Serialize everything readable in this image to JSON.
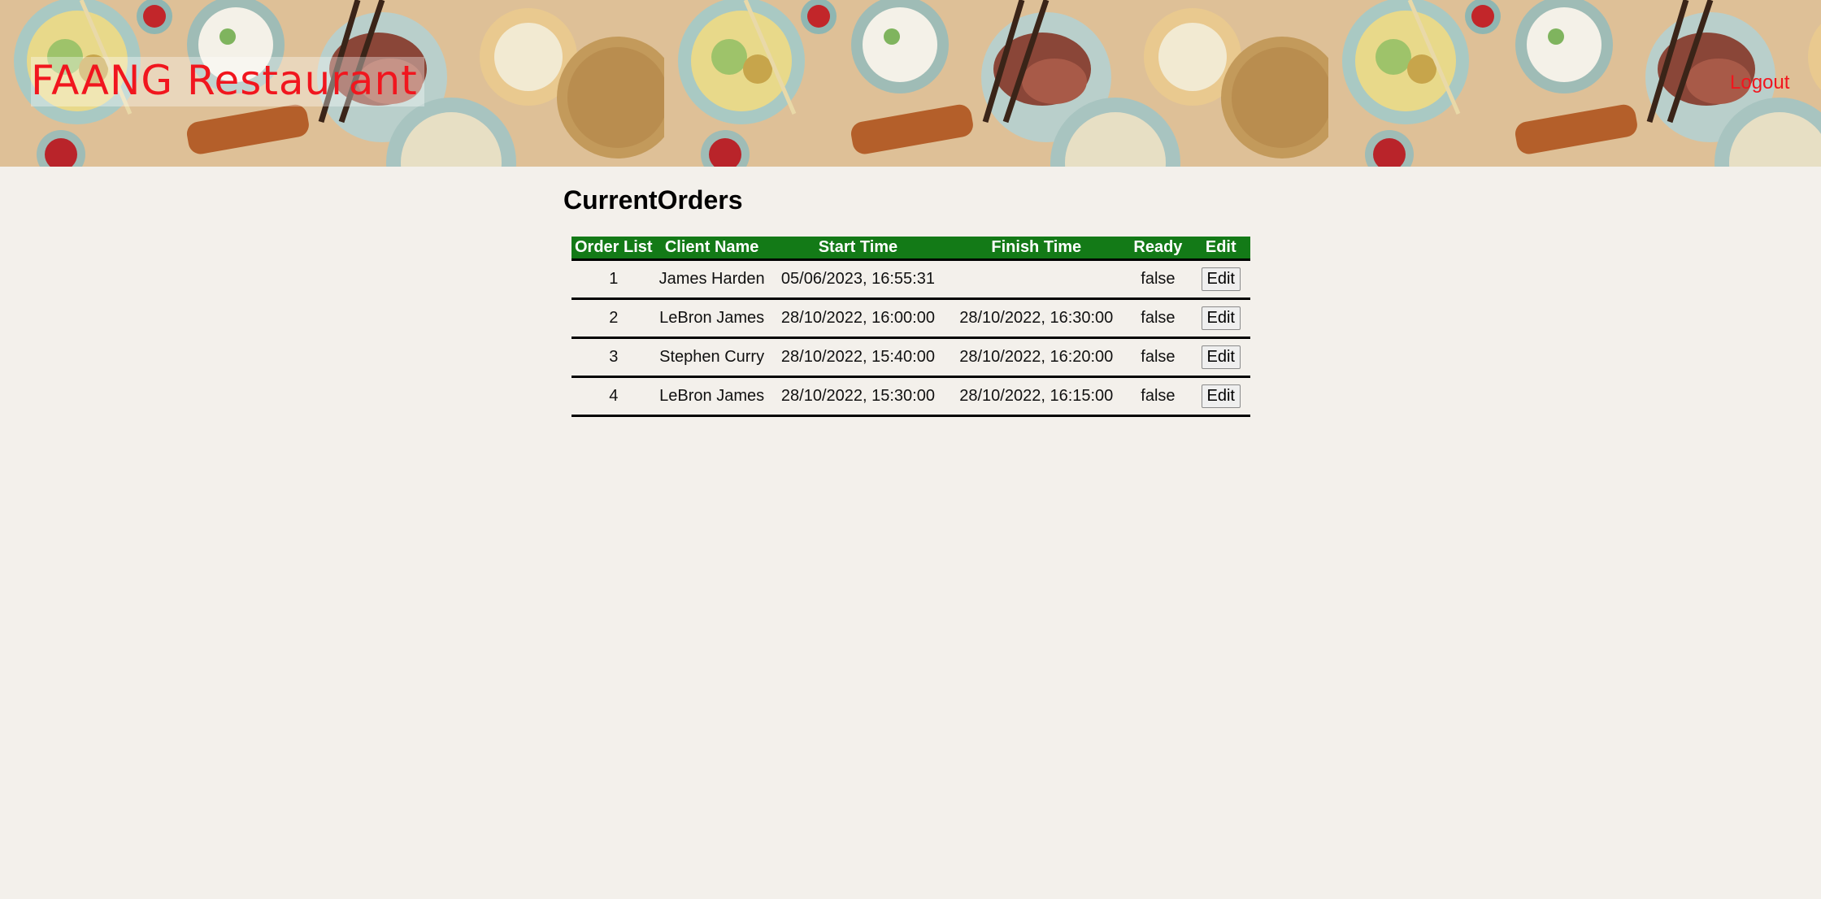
{
  "header": {
    "brand": "FAANG Restaurant",
    "logout_label": "Logout"
  },
  "page": {
    "title": "CurrentOrders"
  },
  "table": {
    "columns": [
      "Order List",
      "Client Name",
      "Start Time",
      "Finish Time",
      "Ready",
      "Edit"
    ],
    "rows": [
      {
        "order": "1",
        "client": "James Harden",
        "start": "05/06/2023, 16:55:31",
        "finish": "",
        "ready": "false",
        "edit": "Edit"
      },
      {
        "order": "2",
        "client": "LeBron James",
        "start": "28/10/2022, 16:00:00",
        "finish": "28/10/2022, 16:30:00",
        "ready": "false",
        "edit": "Edit"
      },
      {
        "order": "3",
        "client": "Stephen Curry",
        "start": "28/10/2022, 15:40:00",
        "finish": "28/10/2022, 16:20:00",
        "ready": "false",
        "edit": "Edit"
      },
      {
        "order": "4",
        "client": "LeBron James",
        "start": "28/10/2022, 15:30:00",
        "finish": "28/10/2022, 16:15:00",
        "ready": "false",
        "edit": "Edit"
      }
    ]
  },
  "colors": {
    "accent_red": "#f1161e",
    "header_green": "#137a17",
    "background": "#f3f0eb"
  }
}
